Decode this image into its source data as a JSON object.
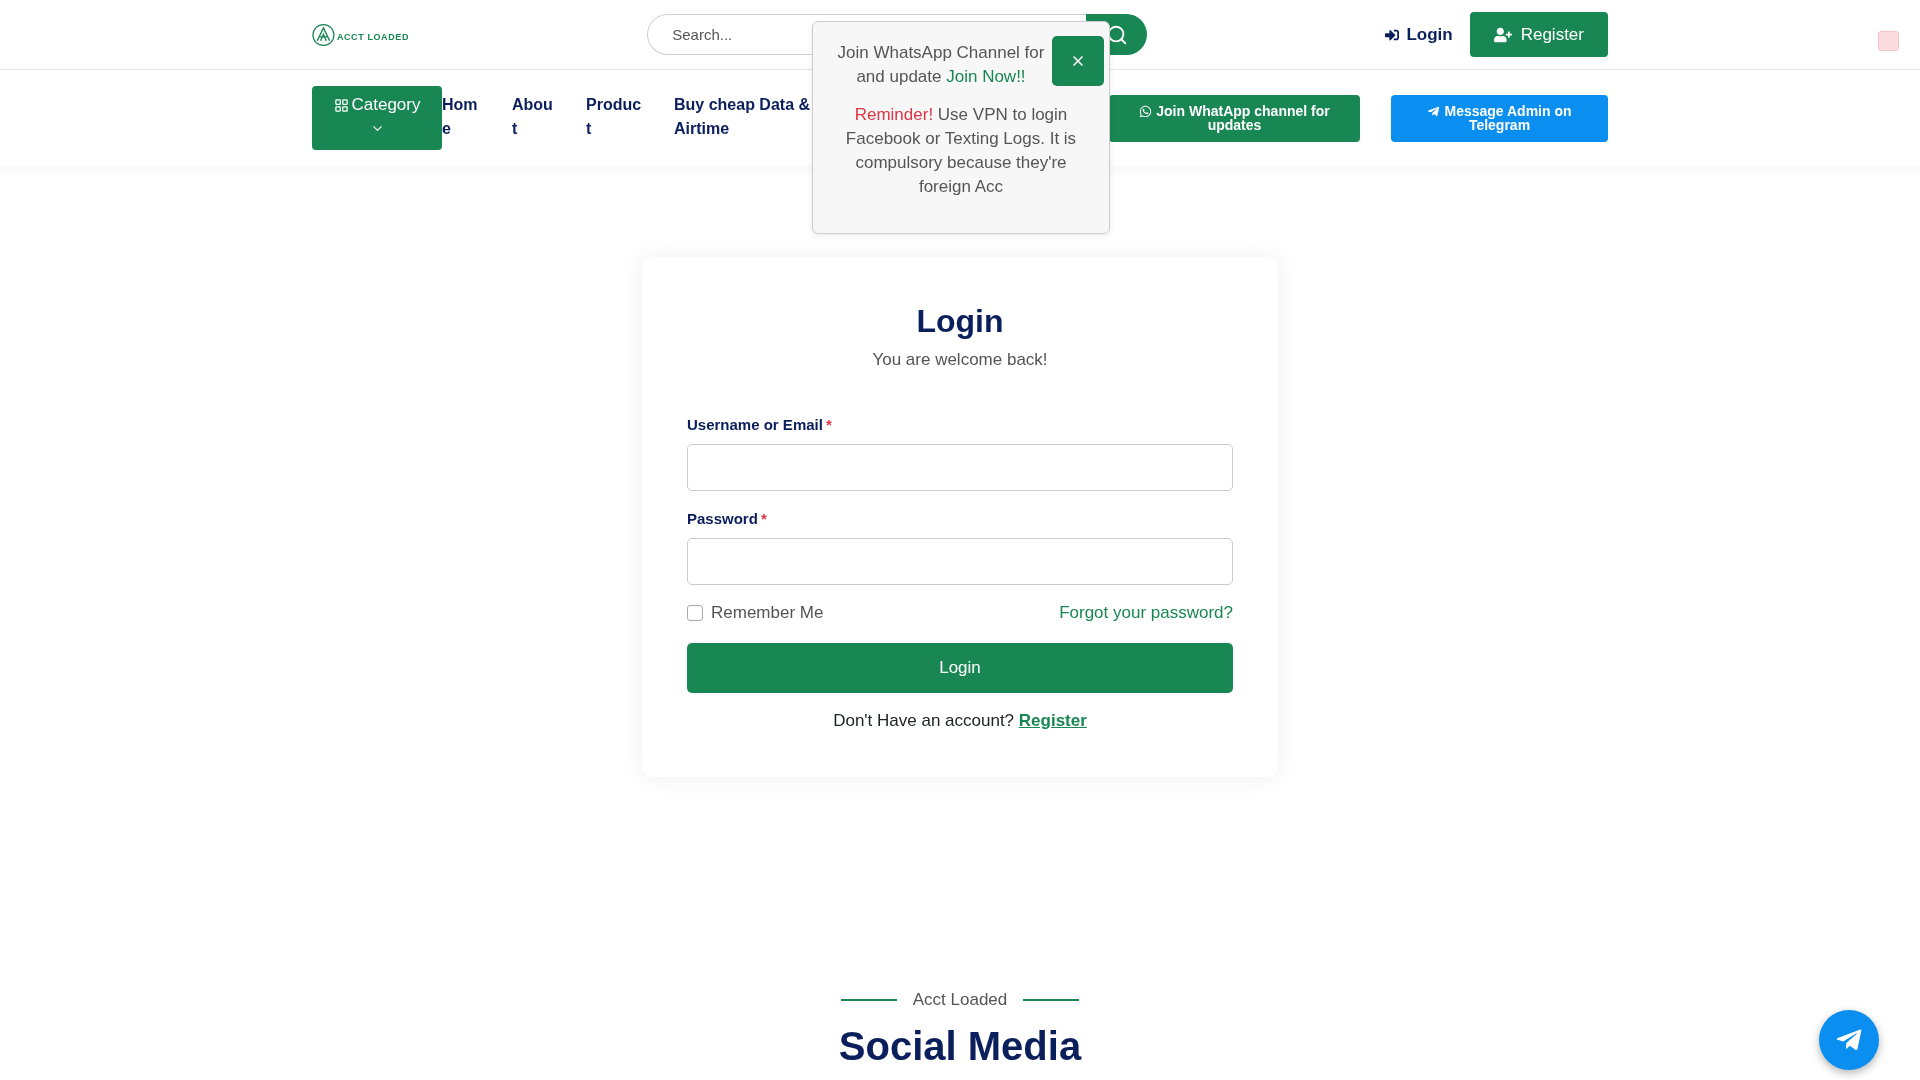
{
  "header": {
    "logo_text": "ACCT LOADED",
    "search": {
      "placeholder": "Search..."
    },
    "login_link": "Login",
    "register_button": "Register"
  },
  "nav": {
    "category_button": "Category",
    "items": [
      "Home",
      "About",
      "Product",
      "Buy cheap Data & Airtime"
    ],
    "whatsapp_button": "Join WhatApp channel for updates",
    "telegram_button": "Message Admin on Telegram"
  },
  "popup": {
    "message": "Join WhatsApp Channel for and update",
    "link": "Join Now!!",
    "reminder_label": "Reminder!",
    "reminder_text": "Use VPN to login Facebook or Texting Logs. It is compulsory because they're foreign Acc"
  },
  "login_form": {
    "title": "Login",
    "subtitle": "You are welcome back!",
    "fields": [
      {
        "label": "Username or Email",
        "required_mark": "*"
      },
      {
        "label": "Password",
        "required_mark": "*"
      }
    ],
    "remember": {
      "label": "Remember Me",
      "checked": false
    },
    "forgot_link": "Forgot your password?",
    "submit": "Login",
    "signup_prompt": "Don't Have an account?",
    "signup_link": "Register"
  },
  "social_section": {
    "eyebrow": "Acct Loaded",
    "title": "Social Media"
  }
}
